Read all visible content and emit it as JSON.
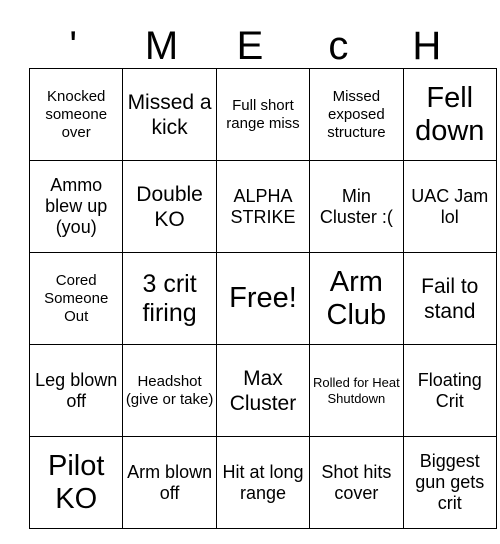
{
  "card": {
    "title_letters": [
      "'",
      "M",
      "E",
      "c",
      "H"
    ],
    "free_space_label": "Free!",
    "colors": {
      "background": "#ffffff",
      "text": "#000000",
      "border": "#000000"
    },
    "grid_size": "5x5",
    "rows": [
      [
        {
          "text": "Knocked someone over",
          "size": "fs-sm"
        },
        {
          "text": "Missed a kick",
          "size": "fs-lg"
        },
        {
          "text": "Full short range miss",
          "size": "fs-sm"
        },
        {
          "text": "Missed exposed structure",
          "size": "fs-sm"
        },
        {
          "text": "Fell down",
          "size": "fs-xxl"
        }
      ],
      [
        {
          "text": "Ammo blew up (you)",
          "size": "fs-md"
        },
        {
          "text": "Double KO",
          "size": "fs-lg"
        },
        {
          "text": "ALPHA STRIKE",
          "size": "fs-md"
        },
        {
          "text": "Min Cluster :(",
          "size": "fs-md"
        },
        {
          "text": "UAC Jam lol",
          "size": "fs-md"
        }
      ],
      [
        {
          "text": "Cored Someone Out",
          "size": "fs-sm"
        },
        {
          "text": "3 crit firing",
          "size": "fs-xl"
        },
        {
          "text": "Free!",
          "size": "fs-xxl"
        },
        {
          "text": "Arm Club",
          "size": "fs-xxl"
        },
        {
          "text": "Fail to stand",
          "size": "fs-lg"
        }
      ],
      [
        {
          "text": "Leg blown off",
          "size": "fs-md"
        },
        {
          "text": "Headshot (give or take)",
          "size": "fs-sm"
        },
        {
          "text": "Max Cluster",
          "size": "fs-lg"
        },
        {
          "text": "Rolled for Heat Shutdown",
          "size": "fs-xs"
        },
        {
          "text": "Floating Crit",
          "size": "fs-md"
        }
      ],
      [
        {
          "text": "Pilot KO",
          "size": "fs-xxl"
        },
        {
          "text": "Arm blown off",
          "size": "fs-md"
        },
        {
          "text": "Hit at long range",
          "size": "fs-md"
        },
        {
          "text": "Shot hits cover",
          "size": "fs-md"
        },
        {
          "text": "Biggest gun gets crit",
          "size": "fs-md"
        }
      ]
    ]
  }
}
